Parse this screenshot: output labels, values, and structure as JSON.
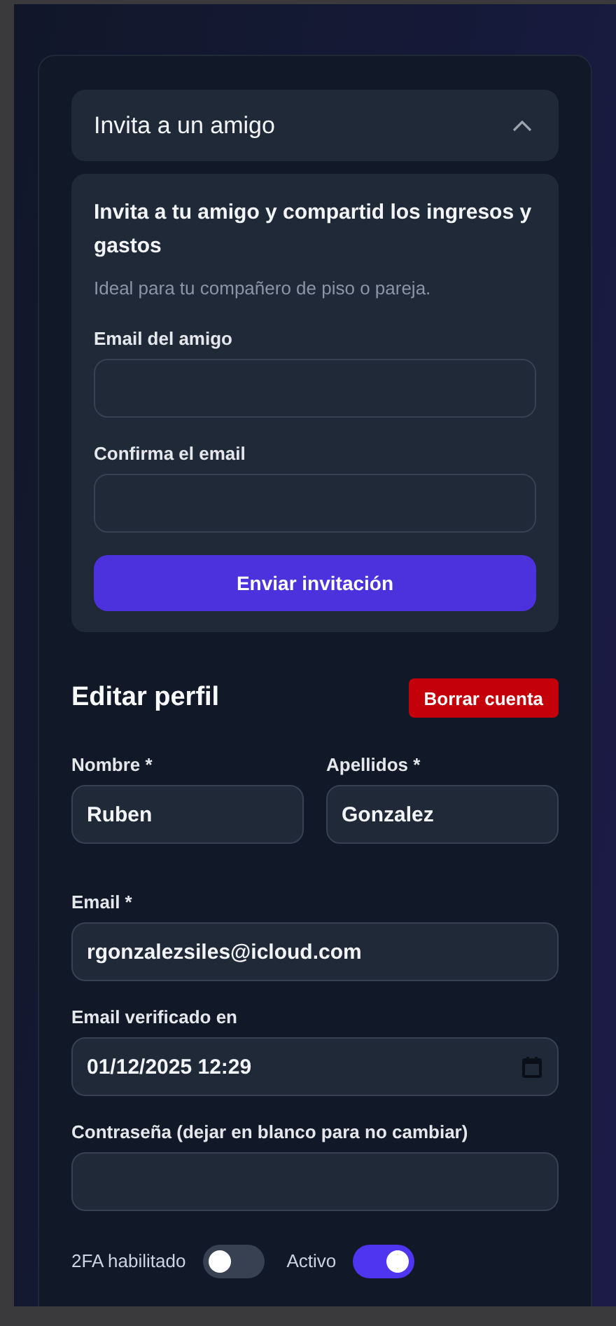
{
  "invite": {
    "title": "Invita a un amigo",
    "expanded": true,
    "heading": "Invita a tu amigo y compartid los ingresos y gastos",
    "subtitle": "Ideal para tu compañero de piso o pareja.",
    "fields": [
      {
        "label": "Email del amigo"
      },
      {
        "label": "Confirma el email"
      }
    ],
    "submit": "Enviar invitación"
  },
  "profile": {
    "title": "Editar perfil",
    "delete_button": "Borrar cuenta",
    "rows": [
      {
        "fields": [
          {
            "label": "Nombre *",
            "value": "Ruben",
            "kind": "text"
          },
          {
            "label": "Apellidos *",
            "value": "Gonzalez",
            "kind": "text"
          }
        ]
      },
      {
        "fields": [
          {
            "label": "Email *",
            "value": "rgonzalezsiles@icloud.com",
            "kind": "text"
          }
        ]
      },
      {
        "fields": [
          {
            "label": "Email verificado en",
            "value": "01/12/2025 12:29",
            "kind": "datetime"
          }
        ]
      },
      {
        "fields": [
          {
            "label": "Contraseña (dejar en blanco para no cambiar)",
            "kind": "password"
          }
        ]
      }
    ],
    "toggles": [
      {
        "label": "2FA habilitado",
        "on": false
      },
      {
        "label": "Activo",
        "on": true
      }
    ]
  }
}
